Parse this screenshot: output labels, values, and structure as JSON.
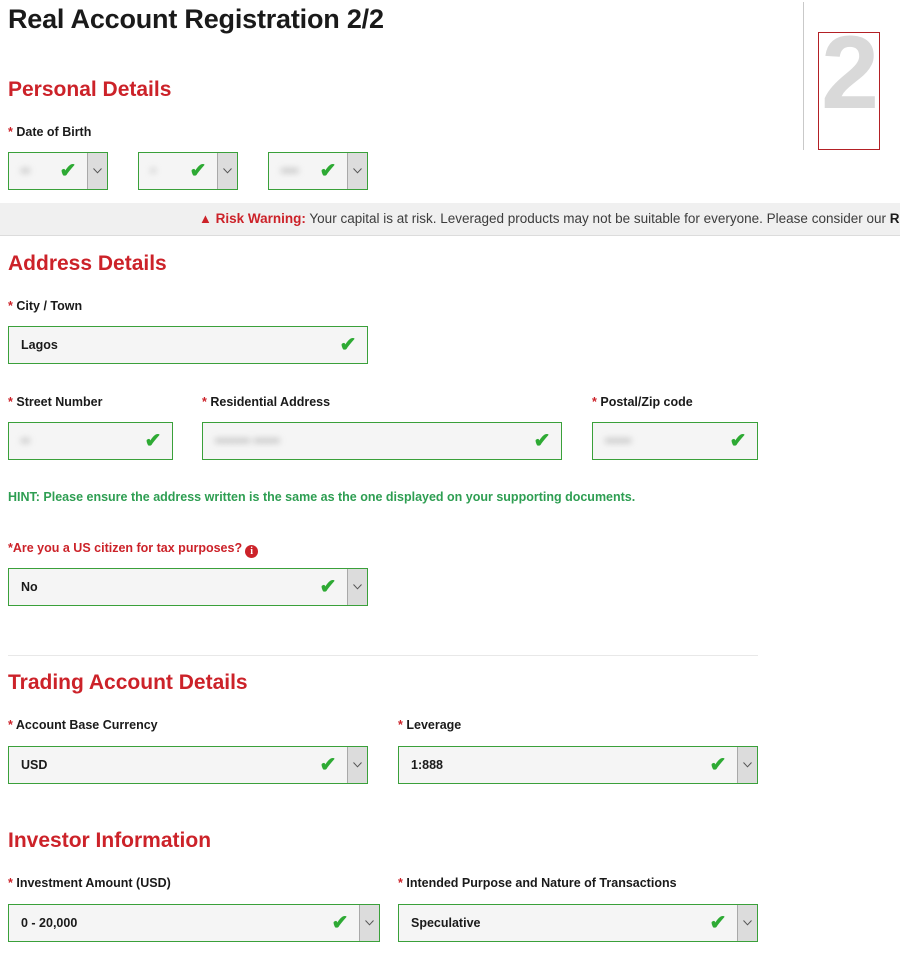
{
  "page": {
    "title": "Real Account Registration 2/2",
    "step_number": "2"
  },
  "risk_banner": {
    "icon": "warning-triangle-icon",
    "warning_label": "Risk Warning:",
    "text": " Your capital is at risk. Leveraged products may not be suitable for everyone. Please consider our ",
    "link_text": "Ris"
  },
  "sections": {
    "personal_details": {
      "heading": "Personal Details",
      "date_of_birth": {
        "label": "Date of Birth",
        "required_mark": "*",
        "day": {
          "value": "••",
          "name": "dob-day-select"
        },
        "month": {
          "value": "•",
          "name": "dob-month-select"
        },
        "year": {
          "value": "••••",
          "name": "dob-year-select"
        }
      }
    },
    "address_details": {
      "heading": "Address Details",
      "city": {
        "label": "City / Town",
        "required_mark": "*",
        "value": "Lagos"
      },
      "street_number": {
        "label": "Street Number",
        "required_mark": "*",
        "value": "••"
      },
      "residential_address": {
        "label": "Residential Address",
        "required_mark": "*",
        "value": "•••••••• ••••••"
      },
      "postal_code": {
        "label": "Postal/Zip code",
        "required_mark": "*",
        "value": "••••••"
      },
      "hint": "HINT: Please ensure the address written is the same as the one displayed on your supporting documents.",
      "us_citizen": {
        "label": "*Are you a US citizen for tax purposes?",
        "info_icon": "info-icon",
        "value": "No"
      }
    },
    "trading_account_details": {
      "heading": "Trading Account Details",
      "base_currency": {
        "label": "Account Base Currency",
        "required_mark": "*",
        "value": "USD"
      },
      "leverage": {
        "label": "Leverage",
        "required_mark": "*",
        "value": "1:888"
      }
    },
    "investor_information": {
      "heading": "Investor Information",
      "investment_amount": {
        "label": "Investment Amount (USD)",
        "required_mark": "*",
        "value": "0 - 20,000"
      },
      "intended_purpose": {
        "label": "Intended Purpose and Nature of Transactions",
        "required_mark": "*",
        "value": "Speculative"
      }
    }
  },
  "icons": {
    "valid_check": "✔",
    "chevron_down": "chevron-down-icon"
  },
  "colors": {
    "brand_red": "#cc2229",
    "valid_green": "#2eaa34",
    "border_green": "#3aa03a",
    "hint_green": "#2e9e52",
    "banner_bg": "#f0f0f0"
  }
}
